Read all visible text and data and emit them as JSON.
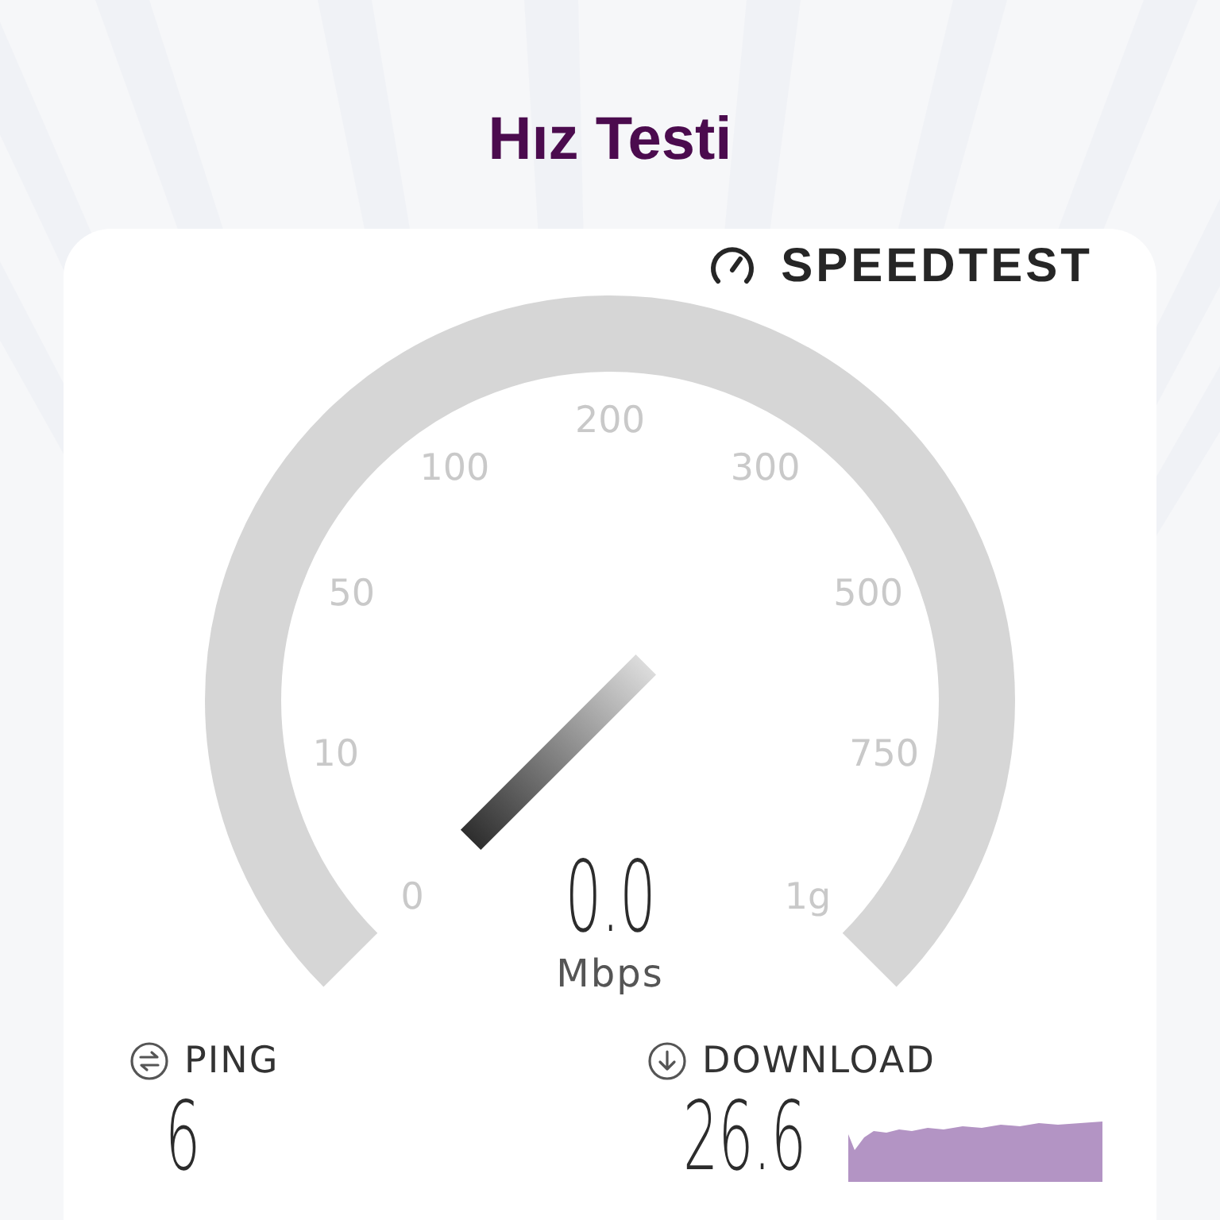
{
  "header": {
    "title": "Hız Testi"
  },
  "logo": {
    "text": "SPEEDTEST"
  },
  "gauge": {
    "scale_labels": [
      "0",
      "10",
      "50",
      "100",
      "200",
      "300",
      "500",
      "750",
      "1g"
    ],
    "reading": "0.0",
    "unit": "Mbps"
  },
  "results": [
    {
      "kind": "ping",
      "label": "PING",
      "value": "6"
    },
    {
      "kind": "download",
      "label": "DOWNLOAD",
      "value": "26.6"
    }
  ]
}
